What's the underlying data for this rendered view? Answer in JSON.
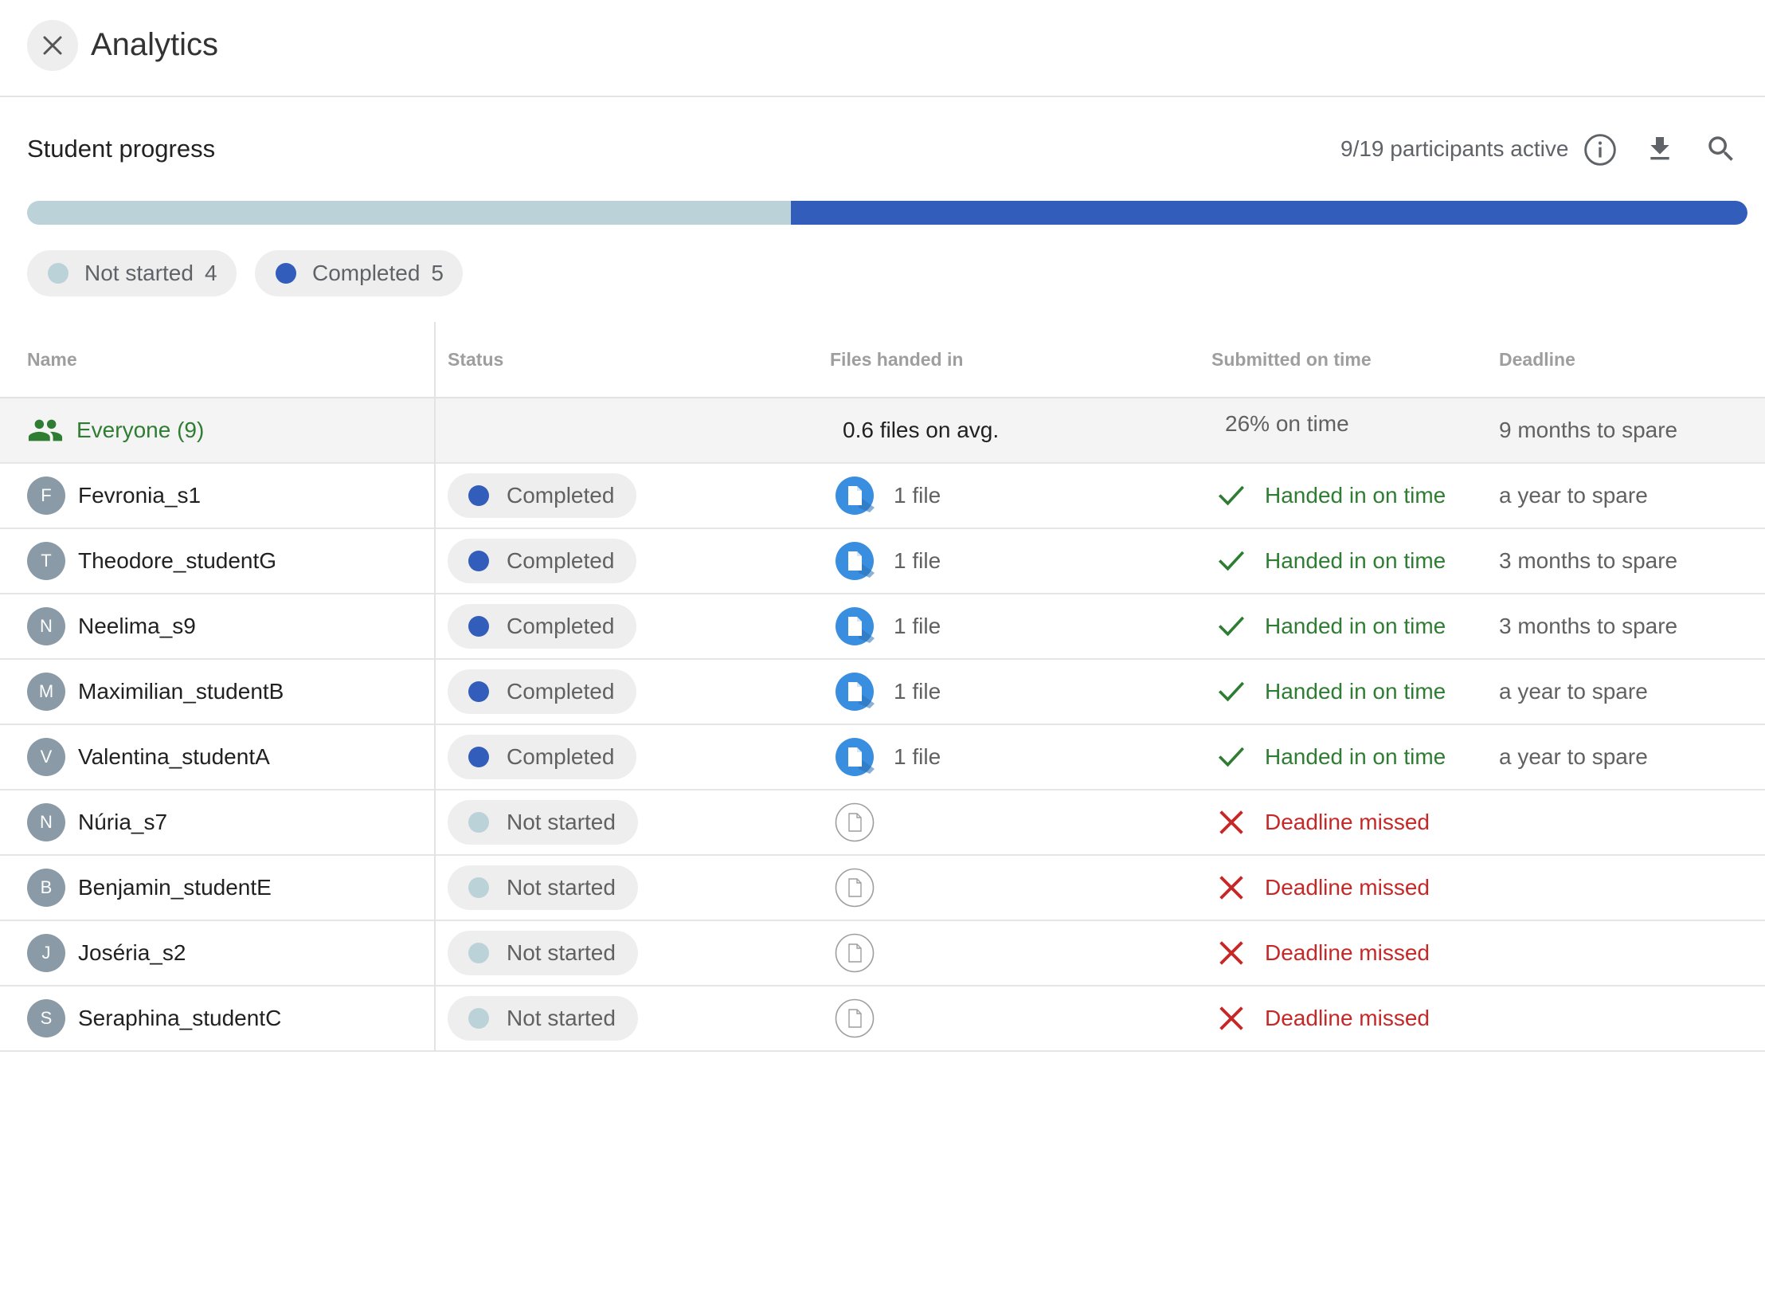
{
  "header": {
    "title": "Analytics"
  },
  "section": {
    "title": "Student progress",
    "participants": "9/19 participants active"
  },
  "progress": {
    "completed_fraction": 0.556,
    "colors": {
      "not_started": "#bcd2d9",
      "completed": "#325dba"
    }
  },
  "legend": [
    {
      "label": "Not started",
      "count": "4",
      "color": "#bcd2d9"
    },
    {
      "label": "Completed",
      "count": "5",
      "color": "#325dba"
    }
  ],
  "table": {
    "headers": {
      "name": "Name",
      "status": "Status",
      "files": "Files handed in",
      "ontime": "Submitted on time",
      "deadline": "Deadline"
    },
    "summary": {
      "name": "Everyone (9)",
      "files": "0.6 files on avg.",
      "ontime": "26% on time",
      "deadline": "9 months to spare",
      "icon": "group-icon"
    },
    "rows": [
      {
        "initial": "F",
        "name": "Fevronia_s1",
        "status": "Completed",
        "files": "1 file",
        "ontime": "Handed in on time",
        "deadline": "a year to spare"
      },
      {
        "initial": "T",
        "name": "Theodore_studentG",
        "status": "Completed",
        "files": "1 file",
        "ontime": "Handed in on time",
        "deadline": "3 months to spare"
      },
      {
        "initial": "N",
        "name": "Neelima_s9",
        "status": "Completed",
        "files": "1 file",
        "ontime": "Handed in on time",
        "deadline": "3 months to spare"
      },
      {
        "initial": "M",
        "name": "Maximilian_studentB",
        "status": "Completed",
        "files": "1 file",
        "ontime": "Handed in on time",
        "deadline": "a year to spare"
      },
      {
        "initial": "V",
        "name": "Valentina_studentA",
        "status": "Completed",
        "files": "1 file",
        "ontime": "Handed in on time",
        "deadline": "a year to spare"
      },
      {
        "initial": "N",
        "name": "Núria_s7",
        "status": "Not started",
        "files": "",
        "ontime": "Deadline missed",
        "deadline": ""
      },
      {
        "initial": "B",
        "name": "Benjamin_studentE",
        "status": "Not started",
        "files": "",
        "ontime": "Deadline missed",
        "deadline": ""
      },
      {
        "initial": "J",
        "name": "Joséria_s2",
        "status": "Not started",
        "files": "",
        "ontime": "Deadline missed",
        "deadline": ""
      },
      {
        "initial": "S",
        "name": "Seraphina_studentC",
        "status": "Not started",
        "files": "",
        "ontime": "Deadline missed",
        "deadline": ""
      }
    ]
  },
  "colors": {
    "ok": "#2e7d32",
    "missed": "#c62828",
    "file_icon": "#3a8ee0"
  },
  "icons": {
    "close": "close-icon",
    "info": "info-icon",
    "download": "download-icon",
    "search": "search-icon"
  }
}
